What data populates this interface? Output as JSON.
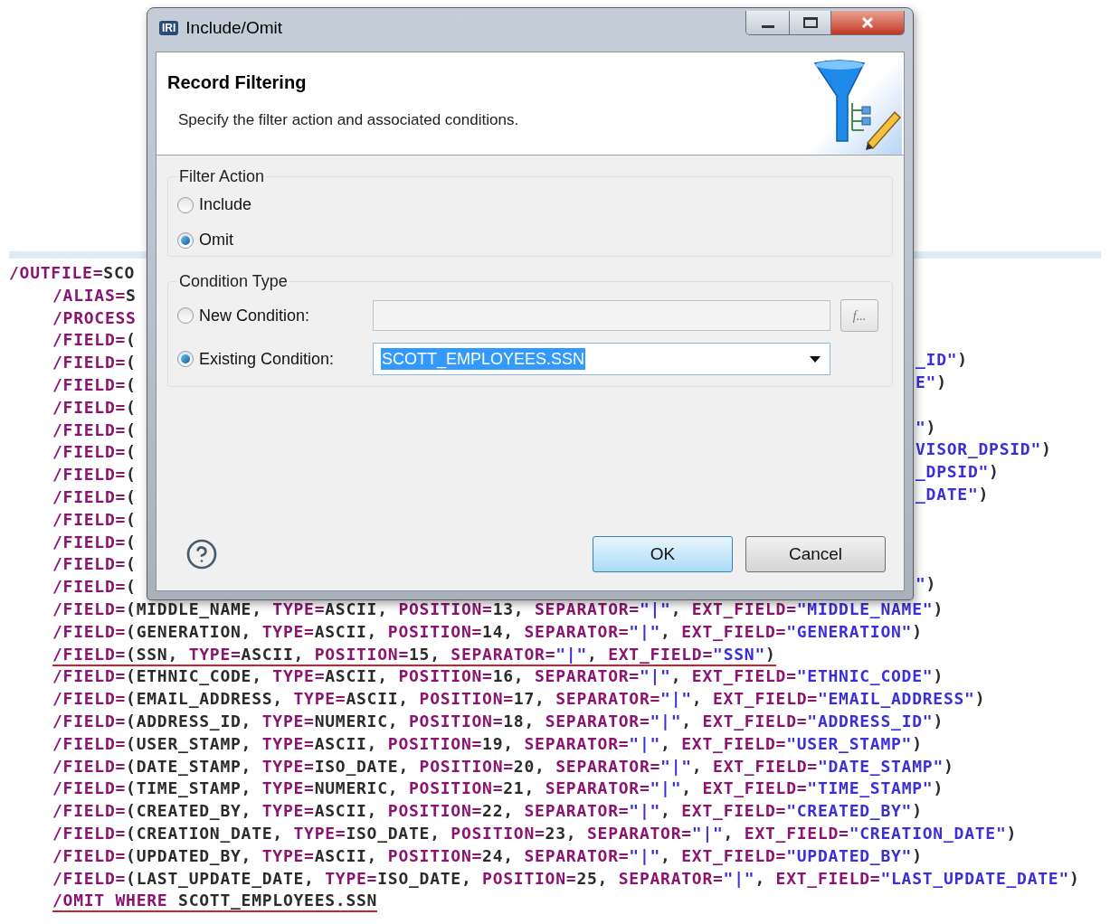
{
  "editor": {
    "lines": [
      {
        "underlined": false,
        "parts": [
          {
            "kind": "kw",
            "text": "/OUTFILE="
          },
          {
            "kind": "plain",
            "text": "SCO"
          }
        ],
        "children": [
          {
            "underlined": false,
            "parts": [
              {
                "kind": "kw",
                "text": "/ALIAS="
              },
              {
                "kind": "plain",
                "text": "S"
              }
            ]
          },
          {
            "underlined": false,
            "parts": [
              {
                "kind": "kw",
                "text": "/PROCESS"
              }
            ]
          },
          {
            "underlined": false,
            "parts": [
              {
                "kind": "kw",
                "text": "/FIELD="
              },
              {
                "kind": "plain",
                "text": "("
              }
            ]
          },
          {
            "underlined": false,
            "parts": [
              {
                "kind": "kw",
                "text": "/FIELD="
              },
              {
                "kind": "plain",
                "text": "("
              }
            ],
            "right_parts": [
              {
                "kind": "str",
                "text": "_ID\""
              },
              {
                "kind": "plain",
                "text": ")"
              }
            ]
          },
          {
            "underlined": false,
            "parts": [
              {
                "kind": "kw",
                "text": "/FIELD="
              },
              {
                "kind": "plain",
                "text": "("
              }
            ],
            "right_parts": [
              {
                "kind": "str",
                "text": "E\""
              },
              {
                "kind": "plain",
                "text": ")"
              }
            ]
          },
          {
            "underlined": false,
            "parts": [
              {
                "kind": "kw",
                "text": "/FIELD="
              },
              {
                "kind": "plain",
                "text": "("
              }
            ]
          },
          {
            "underlined": false,
            "parts": [
              {
                "kind": "kw",
                "text": "/FIELD="
              },
              {
                "kind": "plain",
                "text": "("
              }
            ],
            "right_parts": [
              {
                "kind": "str",
                "text": "\""
              },
              {
                "kind": "plain",
                "text": ")"
              }
            ]
          },
          {
            "underlined": false,
            "parts": [
              {
                "kind": "kw",
                "text": "/FIELD="
              },
              {
                "kind": "plain",
                "text": "("
              }
            ],
            "right_parts": [
              {
                "kind": "str",
                "text": "VISOR_DPSID\""
              },
              {
                "kind": "plain",
                "text": ")"
              }
            ]
          },
          {
            "underlined": false,
            "parts": [
              {
                "kind": "kw",
                "text": "/FIELD="
              },
              {
                "kind": "plain",
                "text": "("
              }
            ],
            "right_parts": [
              {
                "kind": "str",
                "text": "_DPSID\""
              },
              {
                "kind": "plain",
                "text": ")"
              }
            ]
          },
          {
            "underlined": false,
            "parts": [
              {
                "kind": "kw",
                "text": "/FIELD="
              },
              {
                "kind": "plain",
                "text": "("
              }
            ],
            "right_parts": [
              {
                "kind": "str",
                "text": "_DATE\""
              },
              {
                "kind": "plain",
                "text": ")"
              }
            ]
          },
          {
            "underlined": false,
            "parts": [
              {
                "kind": "kw",
                "text": "/FIELD="
              },
              {
                "kind": "plain",
                "text": "("
              }
            ]
          },
          {
            "underlined": false,
            "parts": [
              {
                "kind": "kw",
                "text": "/FIELD="
              },
              {
                "kind": "plain",
                "text": "("
              }
            ]
          },
          {
            "underlined": false,
            "parts": [
              {
                "kind": "kw",
                "text": "/FIELD="
              },
              {
                "kind": "plain",
                "text": "("
              }
            ]
          },
          {
            "underlined": false,
            "parts": [
              {
                "kind": "kw",
                "text": "/FIELD="
              },
              {
                "kind": "plain",
                "text": "("
              }
            ],
            "right_parts": [
              {
                "kind": "str",
                "text": "\""
              },
              {
                "kind": "plain",
                "text": ")"
              }
            ]
          },
          {
            "underlined": false,
            "parts": [
              {
                "kind": "kw",
                "text": "/FIELD="
              },
              {
                "kind": "plain",
                "text": "(MIDDLE_NAME, "
              },
              {
                "kind": "kw",
                "text": "TYPE="
              },
              {
                "kind": "plain",
                "text": "ASCII, "
              },
              {
                "kind": "kw",
                "text": "POSITION="
              },
              {
                "kind": "plain",
                "text": "13, "
              },
              {
                "kind": "kw",
                "text": "SEPARATOR="
              },
              {
                "kind": "str",
                "text": "\"|\""
              },
              {
                "kind": "plain",
                "text": ", "
              },
              {
                "kind": "kw",
                "text": "EXT_FIELD="
              },
              {
                "kind": "str",
                "text": "\"MIDDLE_NAME\""
              },
              {
                "kind": "plain",
                "text": ")"
              }
            ]
          },
          {
            "underlined": false,
            "parts": [
              {
                "kind": "kw",
                "text": "/FIELD="
              },
              {
                "kind": "plain",
                "text": "(GENERATION, "
              },
              {
                "kind": "kw",
                "text": "TYPE="
              },
              {
                "kind": "plain",
                "text": "ASCII, "
              },
              {
                "kind": "kw",
                "text": "POSITION="
              },
              {
                "kind": "plain",
                "text": "14, "
              },
              {
                "kind": "kw",
                "text": "SEPARATOR="
              },
              {
                "kind": "str",
                "text": "\"|\""
              },
              {
                "kind": "plain",
                "text": ", "
              },
              {
                "kind": "kw",
                "text": "EXT_FIELD="
              },
              {
                "kind": "str",
                "text": "\"GENERATION\""
              },
              {
                "kind": "plain",
                "text": ")"
              }
            ]
          },
          {
            "underlined": true,
            "parts": [
              {
                "kind": "kw",
                "text": "/FIELD="
              },
              {
                "kind": "plain",
                "text": "(SSN, "
              },
              {
                "kind": "kw",
                "text": "TYPE="
              },
              {
                "kind": "plain",
                "text": "ASCII, "
              },
              {
                "kind": "kw",
                "text": "POSITION="
              },
              {
                "kind": "plain",
                "text": "15, "
              },
              {
                "kind": "kw",
                "text": "SEPARATOR="
              },
              {
                "kind": "str",
                "text": "\"|\""
              },
              {
                "kind": "plain",
                "text": ", "
              },
              {
                "kind": "kw",
                "text": "EXT_FIELD="
              },
              {
                "kind": "str",
                "text": "\"SSN\""
              },
              {
                "kind": "plain",
                "text": ")"
              }
            ]
          },
          {
            "underlined": false,
            "parts": [
              {
                "kind": "kw",
                "text": "/FIELD="
              },
              {
                "kind": "plain",
                "text": "(ETHNIC_CODE, "
              },
              {
                "kind": "kw",
                "text": "TYPE="
              },
              {
                "kind": "plain",
                "text": "ASCII, "
              },
              {
                "kind": "kw",
                "text": "POSITION="
              },
              {
                "kind": "plain",
                "text": "16, "
              },
              {
                "kind": "kw",
                "text": "SEPARATOR="
              },
              {
                "kind": "str",
                "text": "\"|\""
              },
              {
                "kind": "plain",
                "text": ", "
              },
              {
                "kind": "kw",
                "text": "EXT_FIELD="
              },
              {
                "kind": "str",
                "text": "\"ETHNIC_CODE\""
              },
              {
                "kind": "plain",
                "text": ")"
              }
            ]
          },
          {
            "underlined": false,
            "parts": [
              {
                "kind": "kw",
                "text": "/FIELD="
              },
              {
                "kind": "plain",
                "text": "(EMAIL_ADDRESS, "
              },
              {
                "kind": "kw",
                "text": "TYPE="
              },
              {
                "kind": "plain",
                "text": "ASCII, "
              },
              {
                "kind": "kw",
                "text": "POSITION="
              },
              {
                "kind": "plain",
                "text": "17, "
              },
              {
                "kind": "kw",
                "text": "SEPARATOR="
              },
              {
                "kind": "str",
                "text": "\"|\""
              },
              {
                "kind": "plain",
                "text": ", "
              },
              {
                "kind": "kw",
                "text": "EXT_FIELD="
              },
              {
                "kind": "str",
                "text": "\"EMAIL_ADDRESS\""
              },
              {
                "kind": "plain",
                "text": ")"
              }
            ]
          },
          {
            "underlined": false,
            "parts": [
              {
                "kind": "kw",
                "text": "/FIELD="
              },
              {
                "kind": "plain",
                "text": "(ADDRESS_ID, "
              },
              {
                "kind": "kw",
                "text": "TYPE="
              },
              {
                "kind": "plain",
                "text": "NUMERIC, "
              },
              {
                "kind": "kw",
                "text": "POSITION="
              },
              {
                "kind": "plain",
                "text": "18, "
              },
              {
                "kind": "kw",
                "text": "SEPARATOR="
              },
              {
                "kind": "str",
                "text": "\"|\""
              },
              {
                "kind": "plain",
                "text": ", "
              },
              {
                "kind": "kw",
                "text": "EXT_FIELD="
              },
              {
                "kind": "str",
                "text": "\"ADDRESS_ID\""
              },
              {
                "kind": "plain",
                "text": ")"
              }
            ]
          },
          {
            "underlined": false,
            "parts": [
              {
                "kind": "kw",
                "text": "/FIELD="
              },
              {
                "kind": "plain",
                "text": "(USER_STAMP, "
              },
              {
                "kind": "kw",
                "text": "TYPE="
              },
              {
                "kind": "plain",
                "text": "ASCII, "
              },
              {
                "kind": "kw",
                "text": "POSITION="
              },
              {
                "kind": "plain",
                "text": "19, "
              },
              {
                "kind": "kw",
                "text": "SEPARATOR="
              },
              {
                "kind": "str",
                "text": "\"|\""
              },
              {
                "kind": "plain",
                "text": ", "
              },
              {
                "kind": "kw",
                "text": "EXT_FIELD="
              },
              {
                "kind": "str",
                "text": "\"USER_STAMP\""
              },
              {
                "kind": "plain",
                "text": ")"
              }
            ]
          },
          {
            "underlined": false,
            "parts": [
              {
                "kind": "kw",
                "text": "/FIELD="
              },
              {
                "kind": "plain",
                "text": "(DATE_STAMP, "
              },
              {
                "kind": "kw",
                "text": "TYPE="
              },
              {
                "kind": "plain",
                "text": "ISO_DATE, "
              },
              {
                "kind": "kw",
                "text": "POSITION="
              },
              {
                "kind": "plain",
                "text": "20, "
              },
              {
                "kind": "kw",
                "text": "SEPARATOR="
              },
              {
                "kind": "str",
                "text": "\"|\""
              },
              {
                "kind": "plain",
                "text": ", "
              },
              {
                "kind": "kw",
                "text": "EXT_FIELD="
              },
              {
                "kind": "str",
                "text": "\"DATE_STAMP\""
              },
              {
                "kind": "plain",
                "text": ")"
              }
            ]
          },
          {
            "underlined": false,
            "parts": [
              {
                "kind": "kw",
                "text": "/FIELD="
              },
              {
                "kind": "plain",
                "text": "(TIME_STAMP, "
              },
              {
                "kind": "kw",
                "text": "TYPE="
              },
              {
                "kind": "plain",
                "text": "NUMERIC, "
              },
              {
                "kind": "kw",
                "text": "POSITION="
              },
              {
                "kind": "plain",
                "text": "21, "
              },
              {
                "kind": "kw",
                "text": "SEPARATOR="
              },
              {
                "kind": "str",
                "text": "\"|\""
              },
              {
                "kind": "plain",
                "text": ", "
              },
              {
                "kind": "kw",
                "text": "EXT_FIELD="
              },
              {
                "kind": "str",
                "text": "\"TIME_STAMP\""
              },
              {
                "kind": "plain",
                "text": ")"
              }
            ]
          },
          {
            "underlined": false,
            "parts": [
              {
                "kind": "kw",
                "text": "/FIELD="
              },
              {
                "kind": "plain",
                "text": "(CREATED_BY, "
              },
              {
                "kind": "kw",
                "text": "TYPE="
              },
              {
                "kind": "plain",
                "text": "ASCII, "
              },
              {
                "kind": "kw",
                "text": "POSITION="
              },
              {
                "kind": "plain",
                "text": "22, "
              },
              {
                "kind": "kw",
                "text": "SEPARATOR="
              },
              {
                "kind": "str",
                "text": "\"|\""
              },
              {
                "kind": "plain",
                "text": ", "
              },
              {
                "kind": "kw",
                "text": "EXT_FIELD="
              },
              {
                "kind": "str",
                "text": "\"CREATED_BY\""
              },
              {
                "kind": "plain",
                "text": ")"
              }
            ]
          },
          {
            "underlined": false,
            "parts": [
              {
                "kind": "kw",
                "text": "/FIELD="
              },
              {
                "kind": "plain",
                "text": "(CREATION_DATE, "
              },
              {
                "kind": "kw",
                "text": "TYPE="
              },
              {
                "kind": "plain",
                "text": "ISO_DATE, "
              },
              {
                "kind": "kw",
                "text": "POSITION="
              },
              {
                "kind": "plain",
                "text": "23, "
              },
              {
                "kind": "kw",
                "text": "SEPARATOR="
              },
              {
                "kind": "str",
                "text": "\"|\""
              },
              {
                "kind": "plain",
                "text": ", "
              },
              {
                "kind": "kw",
                "text": "EXT_FIELD="
              },
              {
                "kind": "str",
                "text": "\"CREATION_DATE\""
              },
              {
                "kind": "plain",
                "text": ")"
              }
            ]
          },
          {
            "underlined": false,
            "parts": [
              {
                "kind": "kw",
                "text": "/FIELD="
              },
              {
                "kind": "plain",
                "text": "(UPDATED_BY, "
              },
              {
                "kind": "kw",
                "text": "TYPE="
              },
              {
                "kind": "plain",
                "text": "ASCII, "
              },
              {
                "kind": "kw",
                "text": "POSITION="
              },
              {
                "kind": "plain",
                "text": "24, "
              },
              {
                "kind": "kw",
                "text": "SEPARATOR="
              },
              {
                "kind": "str",
                "text": "\"|\""
              },
              {
                "kind": "plain",
                "text": ", "
              },
              {
                "kind": "kw",
                "text": "EXT_FIELD="
              },
              {
                "kind": "str",
                "text": "\"UPDATED_BY\""
              },
              {
                "kind": "plain",
                "text": ")"
              }
            ]
          },
          {
            "underlined": false,
            "parts": [
              {
                "kind": "kw",
                "text": "/FIELD="
              },
              {
                "kind": "plain",
                "text": "(LAST_UPDATE_DATE, "
              },
              {
                "kind": "kw",
                "text": "TYPE="
              },
              {
                "kind": "plain",
                "text": "ISO_DATE, "
              },
              {
                "kind": "kw",
                "text": "POSITION="
              },
              {
                "kind": "plain",
                "text": "25, "
              },
              {
                "kind": "kw",
                "text": "SEPARATOR="
              },
              {
                "kind": "str",
                "text": "\"|\""
              },
              {
                "kind": "plain",
                "text": ", "
              },
              {
                "kind": "kw",
                "text": "EXT_FIELD="
              },
              {
                "kind": "str",
                "text": "\"LAST_UPDATE_DATE\""
              },
              {
                "kind": "plain",
                "text": ")"
              }
            ]
          },
          {
            "underlined": true,
            "parts": [
              {
                "kind": "kw",
                "text": "/OMIT WHERE "
              },
              {
                "kind": "plain",
                "text": "SCOTT_EMPLOYEES.SSN"
              }
            ]
          }
        ]
      }
    ]
  },
  "dialog": {
    "logo_text": "IRI",
    "title": "Include/Omit",
    "header": {
      "title": "Record Filtering",
      "description": "Specify the filter action and associated conditions."
    },
    "filter_action": {
      "legend": "Filter Action",
      "options": [
        {
          "label": "Include",
          "selected": false
        },
        {
          "label": "Omit",
          "selected": true
        }
      ]
    },
    "condition_type": {
      "legend": "Condition Type",
      "new_condition": {
        "label": "New Condition:",
        "selected": false,
        "function_button": "f..."
      },
      "existing_condition": {
        "label": "Existing Condition:",
        "selected": true,
        "value": "SCOTT_EMPLOYEES.SSN"
      }
    },
    "buttons": [
      {
        "label": "OK",
        "default": true
      },
      {
        "label": "Cancel",
        "default": false
      }
    ]
  }
}
